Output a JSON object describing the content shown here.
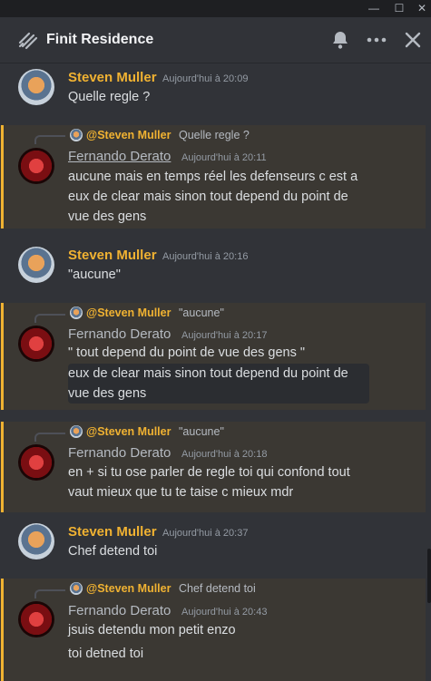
{
  "window": {
    "minimize_label": "—",
    "maximize_label": "☐",
    "close_label": "✕"
  },
  "header": {
    "title": "Finit Residence",
    "icons": [
      "thread-icon",
      "bell-icon",
      "more-icon",
      "close-icon"
    ]
  },
  "colors": {
    "background": "#313338",
    "highlight": "#3b3833",
    "highlight_bar": "#f0b232",
    "steven_name": "#f0b232",
    "fernando_name": "#b5bac1"
  },
  "messages": [
    {
      "author": "Steven Muller",
      "time": "Aujourd'hui à 20:09",
      "lines": [
        "Quelle regle ?"
      ]
    },
    {
      "reply_to": {
        "author": "@Steven Muller",
        "text": "Quelle regle ?"
      },
      "author": "Fernando Derato",
      "time": "Aujourd'hui à 20:11",
      "lines": [
        "aucune mais en temps réel les defenseurs c est a eux de clear mais sinon tout depend du point de vue des gens"
      ]
    },
    {
      "author": "Steven Muller",
      "time": "Aujourd'hui à 20:16",
      "lines": [
        "\"aucune\""
      ]
    },
    {
      "reply_to": {
        "author": "@Steven Muller",
        "text": "\"aucune\""
      },
      "author": "Fernando Derato",
      "time": "Aujourd'hui à 20:17",
      "lines": [
        "\" tout depend du point de vue des gens \"",
        "eux de clear mais sinon tout depend du point de vue des gens"
      ]
    },
    {
      "reply_to": {
        "author": "@Steven Muller",
        "text": "\"aucune\""
      },
      "author": "Fernando Derato",
      "time": "Aujourd'hui à 20:18",
      "lines": [
        "en + si tu ose parler de regle toi qui confond tout vaut mieux que tu te taise c mieux mdr"
      ]
    },
    {
      "author": "Steven Muller",
      "time": "Aujourd'hui à 20:37",
      "lines": [
        "Chef detend toi"
      ]
    },
    {
      "reply_to": {
        "author": "@Steven Muller",
        "text": "Chef detend toi"
      },
      "author": "Fernando Derato",
      "time": "Aujourd'hui à 20:43",
      "lines": [
        "jsuis detendu mon petit enzo",
        "toi detned toi"
      ]
    }
  ]
}
